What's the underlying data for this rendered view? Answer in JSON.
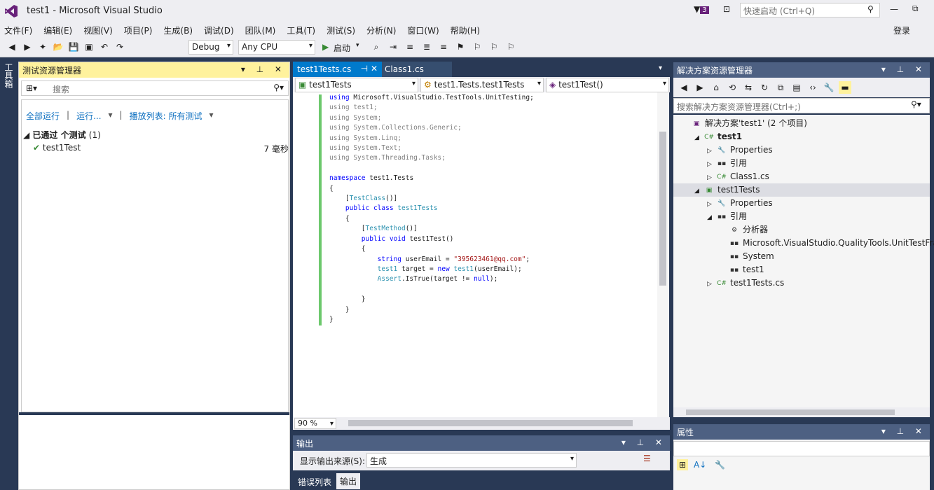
{
  "window": {
    "title": "test1 - Microsoft Visual Studio",
    "quick_launch_placeholder": "快速启动 (Ctrl+Q)",
    "notifications_count": "3",
    "login": "登录"
  },
  "menu": [
    "文件(F)",
    "编辑(E)",
    "视图(V)",
    "项目(P)",
    "生成(B)",
    "调试(D)",
    "团队(M)",
    "工具(T)",
    "测试(S)",
    "分析(N)",
    "窗口(W)",
    "帮助(H)"
  ],
  "toolbar": {
    "config": "Debug",
    "platform": "Any CPU",
    "start": "启动"
  },
  "side_tab": "工具箱",
  "test_explorer": {
    "title": "测试资源管理器",
    "search_placeholder": "搜索",
    "run_all": "全部运行",
    "run": "运行...",
    "playlist": "播放列表: 所有测试",
    "group_label": "已通过 个测试",
    "group_count": "(1)",
    "test_name": "test1Test",
    "test_time": "7 毫秒"
  },
  "editor": {
    "tabs": [
      "test1Tests.cs",
      "Class1.cs"
    ],
    "nav_project": "test1Tests",
    "nav_class": "test1.Tests.test1Tests",
    "nav_method": "test1Test()",
    "zoom": "90 %",
    "lines": [
      "using Microsoft.VisualStudio.TestTools.UnitTesting;",
      "using test1;",
      "using System;",
      "using System.Collections.Generic;",
      "using System.Linq;",
      "using System.Text;",
      "using System.Threading.Tasks;",
      "",
      "namespace test1.Tests",
      "{",
      "    [TestClass()]",
      "    public class test1Tests",
      "    {",
      "        [TestMethod()]",
      "        public void test1Test()",
      "        {",
      "            string userEmail = \"395623461@qq.com\";",
      "            test1 target = new test1(userEmail);",
      "            Assert.IsTrue(target != null);",
      "",
      "        }",
      "    }",
      "}"
    ]
  },
  "output": {
    "title": "输出",
    "source_label": "显示输出来源(S):",
    "source_value": "生成",
    "tabs": [
      "错误列表",
      "输出"
    ]
  },
  "solution": {
    "title": "解决方案资源管理器",
    "search_placeholder": "搜索解决方案资源管理器(Ctrl+;)",
    "items": [
      "解决方案'test1' (2 个项目)",
      "test1",
      "Properties",
      "引用",
      "Class1.cs",
      "test1Tests",
      "Properties",
      "引用",
      "分析器",
      "Microsoft.VisualStudio.QualityTools.UnitTestFram",
      "System",
      "test1",
      "test1Tests.cs"
    ]
  },
  "properties": {
    "title": "属性"
  },
  "colors": {
    "accent": "#68217a",
    "frame": "#293955",
    "active_tab": "#007acc",
    "pass": "#388a34"
  }
}
